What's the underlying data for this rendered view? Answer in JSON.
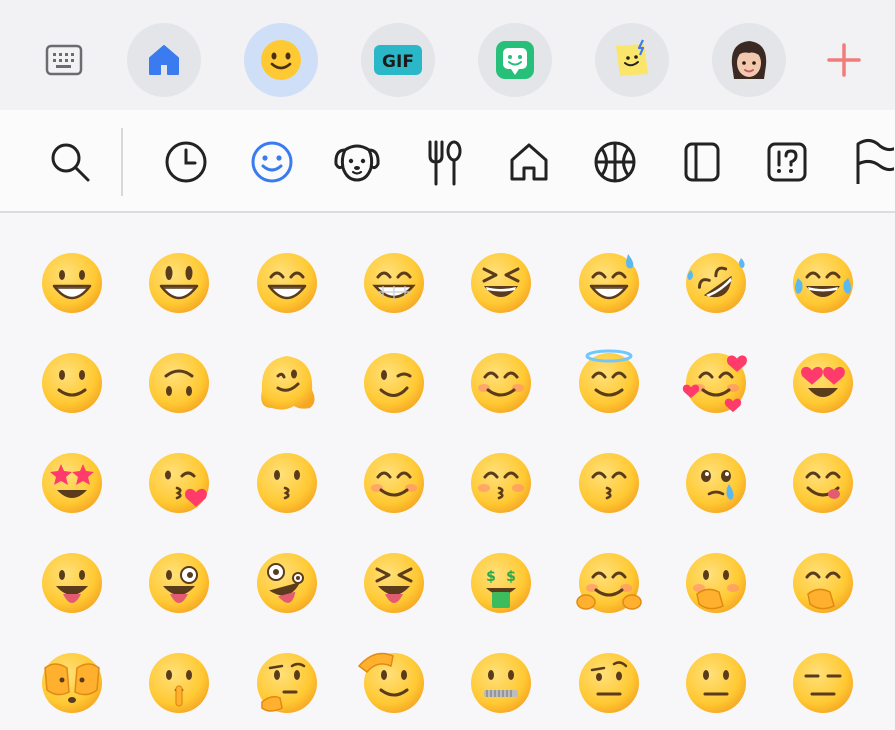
{
  "top_bar": {
    "buttons": [
      {
        "name": "keyboard-button",
        "icon": "keyboard-icon"
      },
      {
        "name": "home-button",
        "icon": "home-icon"
      },
      {
        "name": "emoji-button",
        "icon": "smiley-icon",
        "selected": true
      },
      {
        "name": "gif-button",
        "icon": "gif-icon",
        "label": "GIF"
      },
      {
        "name": "sticker-button",
        "icon": "bitmoji-icon"
      },
      {
        "name": "sticker-pack-button",
        "icon": "sticker-icon"
      },
      {
        "name": "avatar-button",
        "icon": "avatar-icon"
      },
      {
        "name": "add-button",
        "icon": "plus-icon"
      }
    ],
    "colors": {
      "accent": "#3a7cf0",
      "plus": "#f07c7c",
      "gif_bg": "#2ab7c7",
      "sticker_bg": "#27c07a",
      "pack_bg": "#fbe56a"
    }
  },
  "category_bar": {
    "icons": [
      "search-icon",
      "clock-icon",
      "smiley-icon",
      "dog-icon",
      "food-icon",
      "house-icon",
      "ball-icon",
      "object-icon",
      "symbol-icon",
      "flag-icon"
    ],
    "selected": "smiley-icon"
  },
  "emoji_grid": {
    "rows": [
      [
        "grinning-face",
        "grinning-big-eyes",
        "grinning-smiling-eyes",
        "beaming-face",
        "squinting-face",
        "grinning-sweat",
        "rolling-laughing",
        "tears-of-joy"
      ],
      [
        "slightly-smiling",
        "upside-down",
        "melting-face",
        "winking-face",
        "smiling-eyes",
        "smiling-halo",
        "smiling-hearts",
        "heart-eyes"
      ],
      [
        "star-struck",
        "face-blowing-kiss",
        "kissing-face",
        "smiling-face",
        "kissing-closed-eyes",
        "kissing-smiling-eyes",
        "face-holding-tears",
        "face-savoring-food"
      ],
      [
        "tongue-out",
        "winking-tongue",
        "zany-face",
        "squinting-tongue",
        "money-mouth",
        "hugging-face",
        "open-eyes-hand-over-mouth",
        "hand-over-mouth"
      ],
      [
        "peeking-eye",
        "shushing-face",
        "thinking-face",
        "saluting-face",
        "zipper-mouth",
        "raised-eyebrow",
        "neutral-face",
        "expressionless-face"
      ]
    ],
    "colors": {
      "face": "#ffc933",
      "face_dark": "#f5a623",
      "tongue": "#e35b71",
      "heart": "#ff3b6b",
      "eye": "#5a3b1c"
    }
  }
}
